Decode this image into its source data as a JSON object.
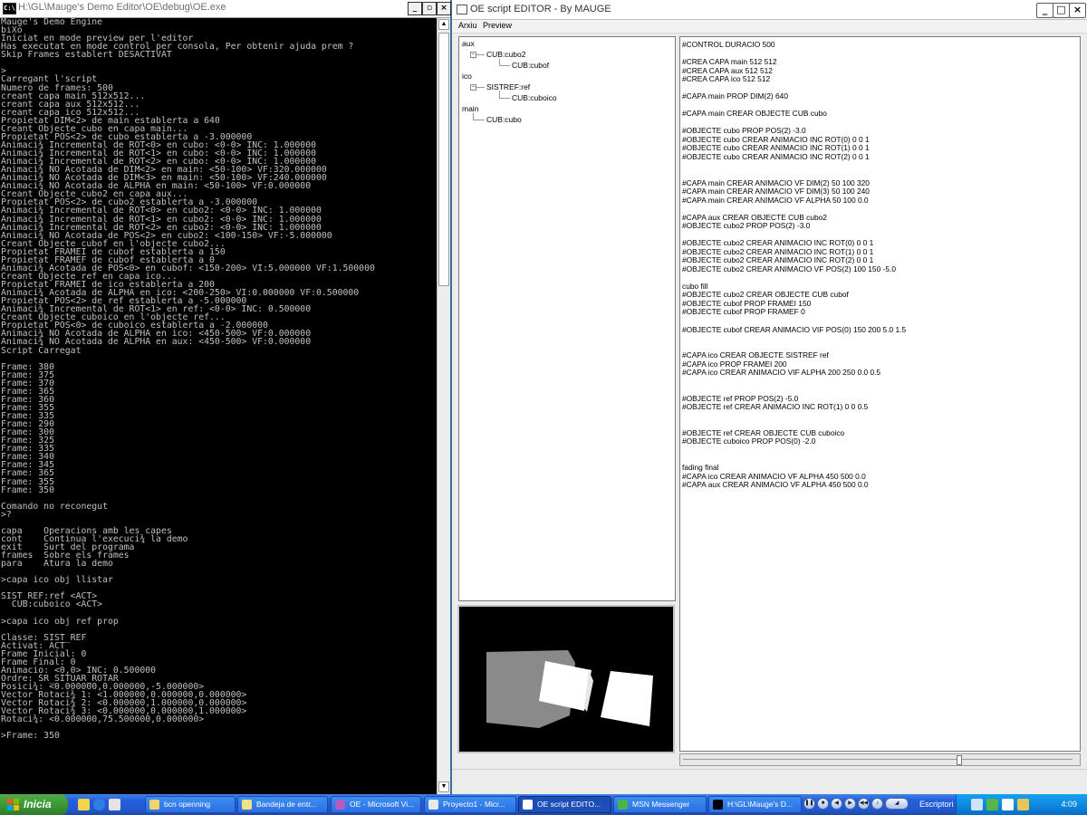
{
  "console": {
    "title": "H:\\GL\\Mauge's Demo Editor\\OE\\debug\\OE.exe",
    "icon_text": "C:\\",
    "lines": [
      "Mauge's Demo Engine",
      "biXo",
      "Iniciat en mode preview per l'editor",
      "Has executat en mode control per consola, Per obtenir ajuda prem ?",
      "Skip Frames establert DESACTIVAT",
      "",
      ">",
      "Carregant l'script",
      "Numero de frames: 500",
      "creant capa main 512x512...",
      "creant capa aux 512x512...",
      "creant capa ico 512x512...",
      "Propietat DIM<2> de main establerta a 640",
      "Creant Objecte cubo en capa main...",
      "Propietat POS<2> de cubo establerta a -3.000000",
      "Animaci¾ Incremental de ROT<0> en cubo: <0-0> INC: 1.000000",
      "Animaci¾ Incremental de ROT<1> en cubo: <0-0> INC: 1.000000",
      "Animaci¾ Incremental de ROT<2> en cubo: <0-0> INC: 1.000000",
      "Animaci¾ NO Acotada de DIM<2> en main: <50-100> VF:320.000000",
      "Animaci¾ NO Acotada de DIM<3> en main: <50-100> VF:240.000000",
      "Animaci¾ NO Acotada de ALPHA en main: <50-100> VF:0.000000",
      "Creant Objecte cubo2 en capa aux...",
      "Propietat POS<2> de cubo2 establerta a -3.000000",
      "Animaci¾ Incremental de ROT<0> en cubo2: <0-0> INC: 1.000000",
      "Animaci¾ Incremental de ROT<1> en cubo2: <0-0> INC: 1.000000",
      "Animaci¾ Incremental de ROT<2> en cubo2: <0-0> INC: 1.000000",
      "Animaci¾ NO Acotada de POS<2> en cubo2: <100-150> VF:-5.000000",
      "Creant Objecte cubof en l'objecte cubo2...",
      "Propietat FRAMEI de cubof establerta a 150",
      "Propietat FRAMEF de cubof establerta a 0",
      "Animaci¾ Acotada de POS<0> en cubof: <150-200> VI:5.000000 VF:1.500000",
      "Creant Objecte ref en capa ico...",
      "Propietat FRAMEI de ico establerta a 200",
      "Animaci¾ Acotada de ALPHA en ico: <200-250> VI:0.000000 VF:0.500000",
      "Propietat POS<2> de ref establerta a -5.000000",
      "Animaci¾ Incremental de ROT<1> en ref: <0-0> INC: 0.500000",
      "Creant Objecte cuboico en l'objecte ref...",
      "Propietat POS<0> de cuboico establerta a -2.000000",
      "Animaci¾ NO Acotada de ALPHA en ico: <450-500> VF:0.000000",
      "Animaci¾ NO Acotada de ALPHA en aux: <450-500> VF:0.000000",
      "Script Carregat",
      "",
      "Frame: 380",
      "Frame: 375",
      "Frame: 370",
      "Frame: 365",
      "Frame: 360",
      "Frame: 355",
      "Frame: 335",
      "Frame: 290",
      "Frame: 300",
      "Frame: 325",
      "Frame: 335",
      "Frame: 340",
      "Frame: 345",
      "Frame: 365",
      "Frame: 355",
      "Frame: 350",
      "",
      "Comando no reconegut",
      ">?",
      "",
      "capa    Operacions amb les capes",
      "cont    Continua l'execuci¾ la demo",
      "exit    Surt del programa",
      "frames  Sobre els frames",
      "para    Atura la demo",
      "",
      ">capa ico obj llistar",
      "",
      "SIST_REF:ref <ACT>",
      "  CUB:cuboico <ACT>",
      "",
      ">capa ico obj ref prop",
      "",
      "Classe: SIST_REF",
      "Activat: ACT",
      "Frame Inicial: 0",
      "Frame Final: 0",
      "Animacio: <0,0> INC: 0.500000",
      "Ordre: SR_SITUAR_ROTAR",
      "Posici¾: <0.000000,0.000000,-5.000000>",
      "Vector Rotaci¾ 1: <1.000000,0.000000,0.000000>",
      "Vector Rotaci¾ 2: <0.000000,1.000000,0.000000>",
      "Vector Rotaci¾ 3: <0.000000,0.000000,1.000000>",
      "Rotaci¾: <0.000000,75.500000,0.000000>",
      "",
      ">Frame: 350"
    ],
    "buttons": {
      "minimize": "_",
      "maximize": "▫",
      "close": "×"
    }
  },
  "editor": {
    "title": "OE script EDITOR - By MAUGE",
    "buttons": {
      "minimize": "_",
      "maximize": "□",
      "close": "×"
    },
    "menu": [
      "Arxiu",
      "Preview"
    ],
    "tree": [
      {
        "label": "aux"
      },
      {
        "label": "CUB:cubo2",
        "toggle": "−"
      },
      {
        "label": "CUB:cubof"
      },
      {
        "label": "ico"
      },
      {
        "label": "SISTREF:ref",
        "toggle": "−"
      },
      {
        "label": "CUB:cuboico"
      },
      {
        "label": "main"
      },
      {
        "label": "CUB:cubo"
      }
    ],
    "script_lines": [
      "#CONTROL DURACIO 500",
      "",
      "#CREA CAPA main 512 512",
      "#CREA CAPA aux 512 512",
      "#CREA CAPA ico 512 512",
      "",
      "#CAPA main PROP DIM(2) 640",
      "",
      "#CAPA main CREAR OBJECTE CUB cubo",
      "",
      "#OBJECTE cubo PROP POS(2) -3.0",
      "#OBJECTE cubo CREAR ANIMACIO INC ROT(0) 0 0 1",
      "#OBJECTE cubo CREAR ANIMACIO INC ROT(1) 0 0 1",
      "#OBJECTE cubo CREAR ANIMACIO INC ROT(2) 0 0 1",
      "",
      "",
      "#CAPA main CREAR ANIMACIO VF DIM(2) 50 100 320",
      "#CAPA main CREAR ANIMACIO VF DIM(3) 50 100 240",
      "#CAPA main CREAR ANIMACIO VF ALPHA 50 100 0.0",
      "",
      "#CAPA aux CREAR OBJECTE CUB cubo2",
      "#OBJECTE cubo2 PROP POS(2) -3.0",
      "",
      "#OBJECTE cubo2 CREAR ANIMACIO INC ROT(0) 0 0 1",
      "#OBJECTE cubo2 CREAR ANIMACIO INC ROT(1) 0 0 1",
      "#OBJECTE cubo2 CREAR ANIMACIO INC ROT(2) 0 0 1",
      "#OBJECTE cubo2 CREAR ANIMACIO VF POS(2) 100 150 -5.0",
      "",
      "cubo fill",
      "#OBJECTE cubo2 CREAR OBJECTE CUB cubof",
      "#OBJECTE cubof PROP FRAMEI 150",
      "#OBJECTE cubof PROP FRAMEF 0",
      "",
      "#OBJECTE cubof CREAR ANIMACIO VIF POS(0) 150 200 5.0 1.5",
      "",
      "",
      "#CAPA ico CREAR OBJECTE SISTREF ref",
      "#CAPA ico PROP FRAMEI 200",
      "#CAPA ico CREAR ANIMACIO VIF ALPHA 200 250 0.0 0.5",
      "",
      "",
      "#OBJECTE ref PROP POS(2) -5.0",
      "#OBJECTE ref CREAR ANIMACIO INC ROT(1) 0 0 0.5",
      "",
      "",
      "#OBJECTE ref CREAR OBJECTE CUB cuboico",
      "#OBJECTE cuboico PROP POS(0) -2.0",
      "",
      "",
      "fading final",
      "#CAPA ico CREAR ANIMACIO VF ALPHA 450 500 0.0",
      "#CAPA aux CREAR ANIMACIO VF ALPHA 450 500 0.0"
    ]
  },
  "taskbar": {
    "start_label": "Inicia",
    "buttons": [
      {
        "label": "bcn openning",
        "icon": "folder-icon",
        "color": "#f2d36b"
      },
      {
        "label": "Bandeja de entr...",
        "icon": "outlook-icon",
        "color": "#f5e08a"
      },
      {
        "label": "OE - Microsoft Vi...",
        "icon": "visual-studio-icon",
        "color": "#b35ac7"
      },
      {
        "label": "Proyecto1 - Micr...",
        "icon": "visual-basic-icon",
        "color": "#e8e8e8"
      },
      {
        "label": "OE script EDITO...",
        "icon": "app-window-icon",
        "color": "#ffffff",
        "active": true
      },
      {
        "label": "MSN Messenger",
        "icon": "msn-icon",
        "color": "#4bb34b"
      },
      {
        "label": "H:\\GL\\Mauge's D...",
        "icon": "console-icon",
        "color": "#000000"
      }
    ],
    "tray_label": "Escriptori",
    "clock": "4:09"
  }
}
